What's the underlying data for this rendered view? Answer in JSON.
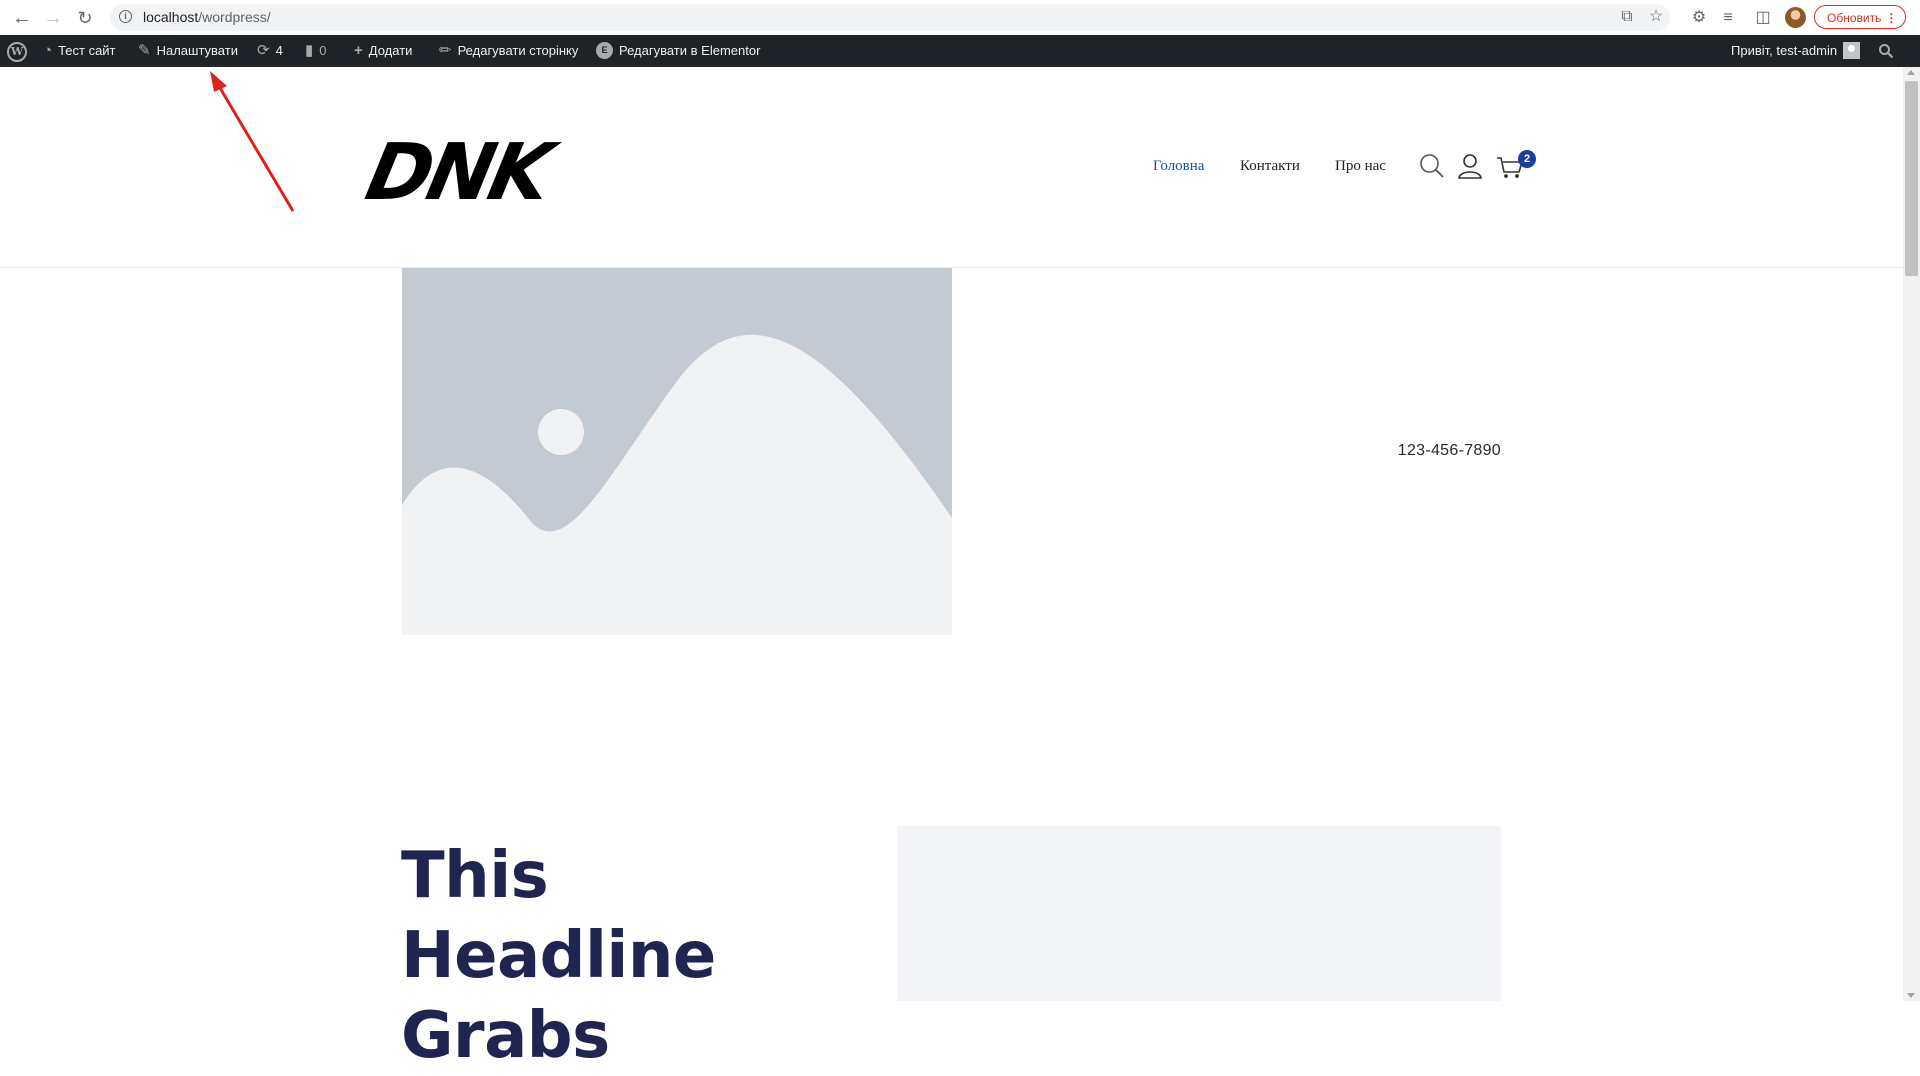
{
  "browser": {
    "url_host": "localhost",
    "url_path": "/wordpress/",
    "update_label": "Обновить"
  },
  "admin_bar": {
    "site_name": "Тест сайт",
    "customize": "Налаштувати",
    "updates_count": "4",
    "comments_count": "0",
    "add_new": "Додати",
    "edit_page": "Редагувати сторінку",
    "edit_elementor": "Редагувати в Elementor",
    "greeting": "Привіт, test-admin"
  },
  "site": {
    "logo_text": "DNK",
    "menu": [
      "Головна",
      "Контакти",
      "Про нас"
    ],
    "active_menu_index": 0,
    "cart_count": "2",
    "accent_color": "#1e4fa8"
  },
  "hero": {
    "phone": "123-456-7890"
  },
  "section": {
    "headline_line1": "This Headline",
    "headline_line2": "Grabs"
  }
}
